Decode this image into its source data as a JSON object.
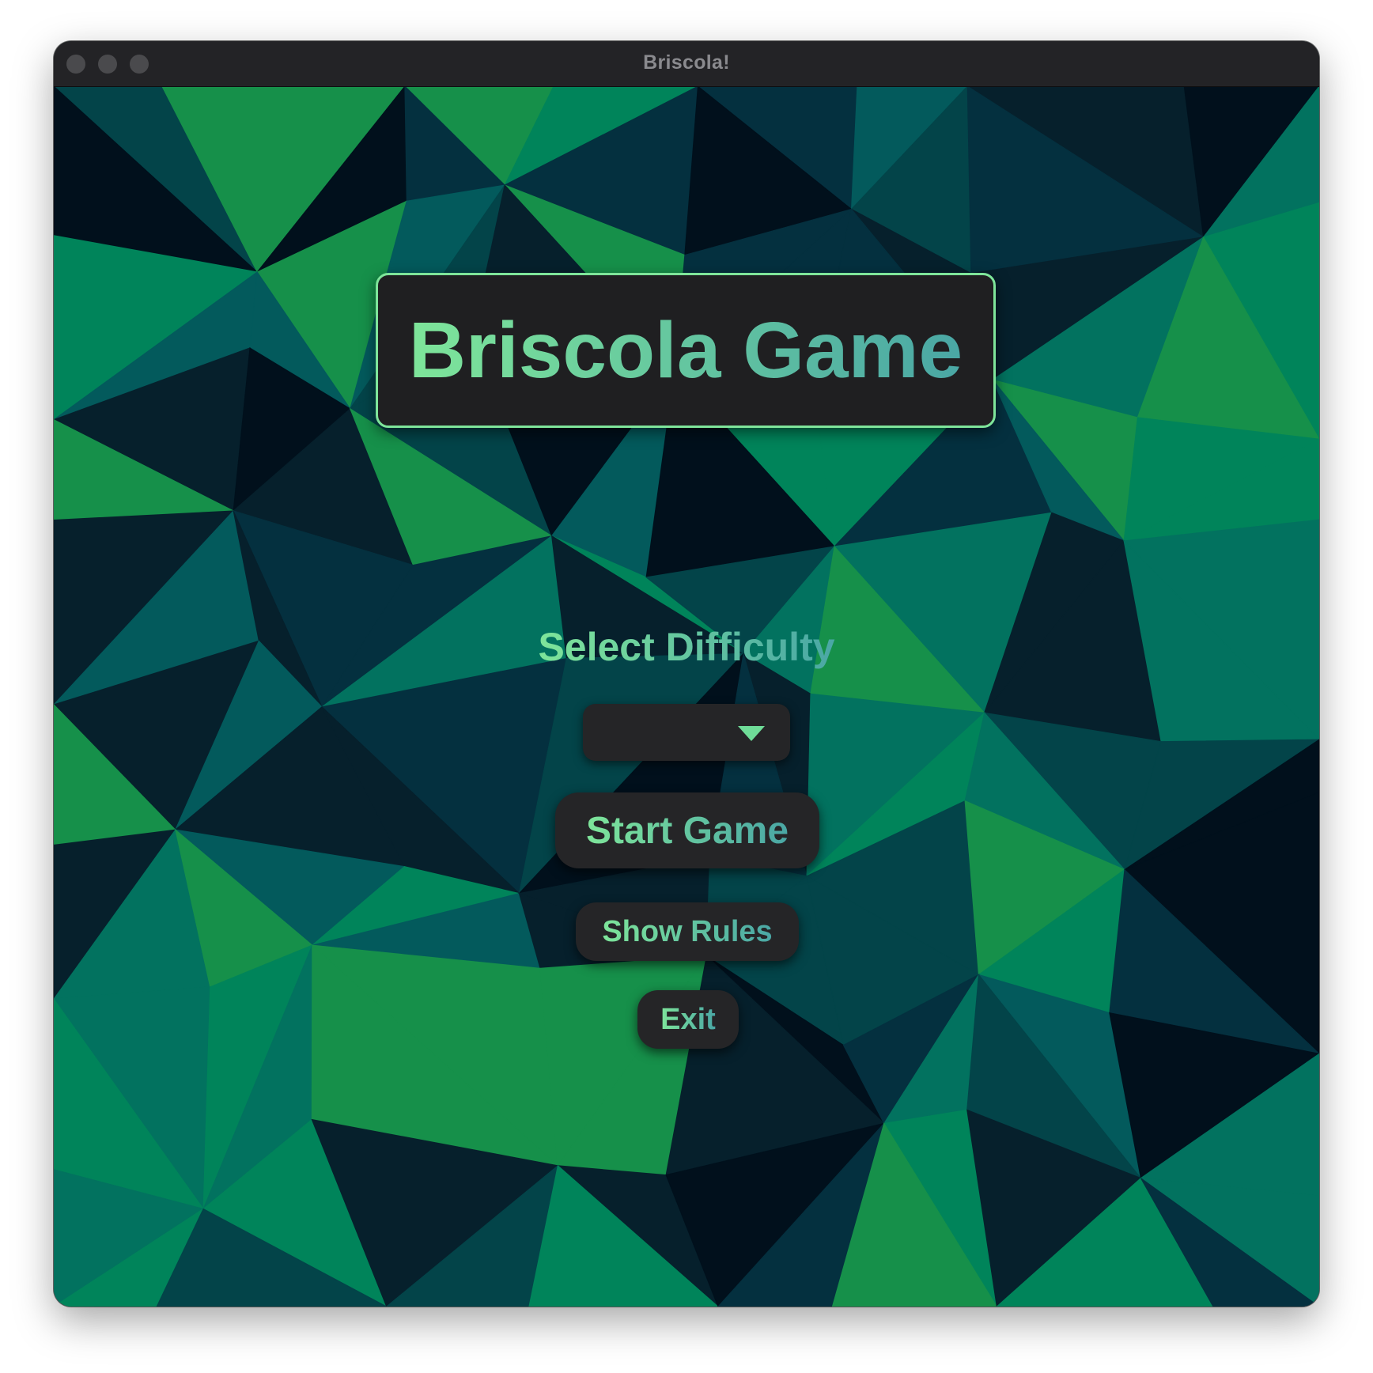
{
  "window": {
    "title": "Briscola!",
    "traffic_lights": [
      "close",
      "minimize",
      "zoom"
    ]
  },
  "title_panel": {
    "title": "Briscola Game"
  },
  "difficulty": {
    "label": "Select Difficulty",
    "selected_value": ""
  },
  "buttons": {
    "start_label": "Start Game",
    "rules_label": "Show Rules",
    "exit_label": "Exit"
  },
  "colors": {
    "accent_green": "#7ee59a",
    "accent_teal": "#4aa7a5",
    "panel_dark": "#1f1f21",
    "bg_palette": [
      "#01101c",
      "#06202c",
      "#04303f",
      "#034449",
      "#035a5c",
      "#02725f",
      "#00845a",
      "#16904a"
    ]
  },
  "icons": {
    "dropdown_caret": "caret-down-icon"
  }
}
